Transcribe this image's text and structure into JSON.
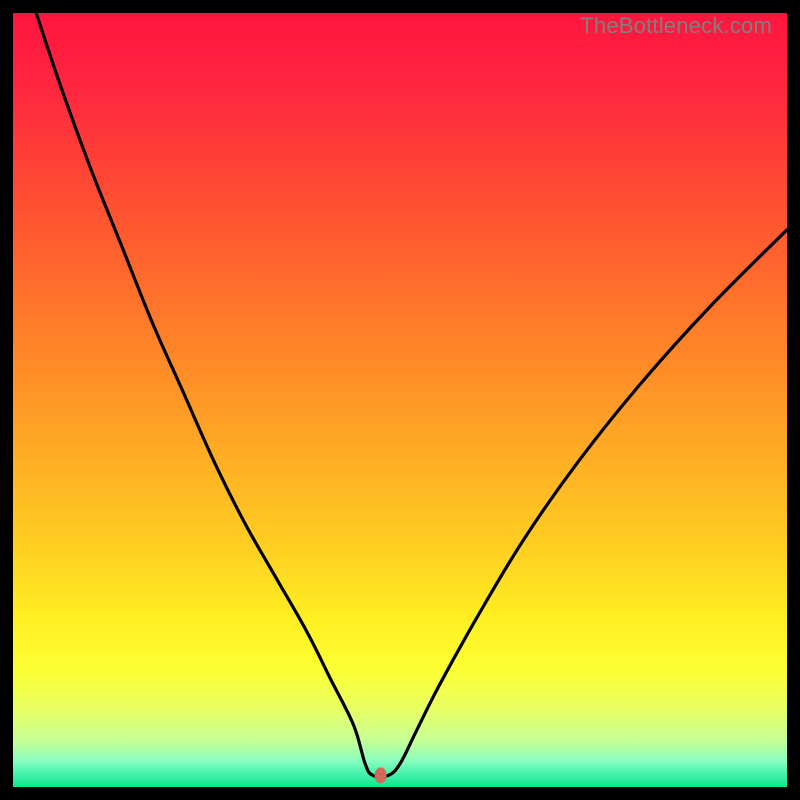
{
  "watermark": "TheBottleneck.com",
  "gradient_stops": [
    {
      "offset": 0.0,
      "color": "#ff153f"
    },
    {
      "offset": 0.1,
      "color": "#ff2740"
    },
    {
      "offset": 0.2,
      "color": "#ff4335"
    },
    {
      "offset": 0.3,
      "color": "#ff5e2f"
    },
    {
      "offset": 0.4,
      "color": "#ff7b29"
    },
    {
      "offset": 0.5,
      "color": "#ff9826"
    },
    {
      "offset": 0.6,
      "color": "#ffb524"
    },
    {
      "offset": 0.7,
      "color": "#ffd222"
    },
    {
      "offset": 0.78,
      "color": "#ffee22"
    },
    {
      "offset": 0.85,
      "color": "#fcff33"
    },
    {
      "offset": 0.9,
      "color": "#e7ff65"
    },
    {
      "offset": 0.94,
      "color": "#c5ff95"
    },
    {
      "offset": 0.965,
      "color": "#8dfec0"
    },
    {
      "offset": 0.985,
      "color": "#3ff0aa"
    },
    {
      "offset": 1.0,
      "color": "#0ee786"
    }
  ],
  "marker": {
    "cx_frac": 0.475,
    "cy_frac": 0.985,
    "rx": 6,
    "ry": 8,
    "fill": "#d36a59"
  },
  "chart_data": {
    "type": "line",
    "title": "",
    "xlabel": "",
    "ylabel": "",
    "xlim": [
      0,
      100
    ],
    "ylim": [
      0,
      100
    ],
    "notes": "Bottleneck-style V-curve. Axes and ticks are not labeled in the source image; values are percent-of-plot coordinates estimated from pixel positions. Minimum near x≈47.",
    "series": [
      {
        "name": "curve",
        "x": [
          3,
          6,
          10,
          14,
          18,
          22,
          26,
          30,
          34,
          38,
          41,
          44,
          45.5,
          46.5,
          48.5,
          50,
          52,
          55,
          60,
          66,
          73,
          81,
          90,
          100
        ],
        "y": [
          100,
          91,
          80,
          70,
          60,
          51,
          42,
          34,
          27,
          20,
          14,
          8,
          3,
          1.5,
          1.5,
          3,
          7,
          13,
          22,
          32,
          42,
          52,
          62,
          72
        ]
      }
    ],
    "marker_point": {
      "x": 47.5,
      "y": 1.5
    }
  }
}
